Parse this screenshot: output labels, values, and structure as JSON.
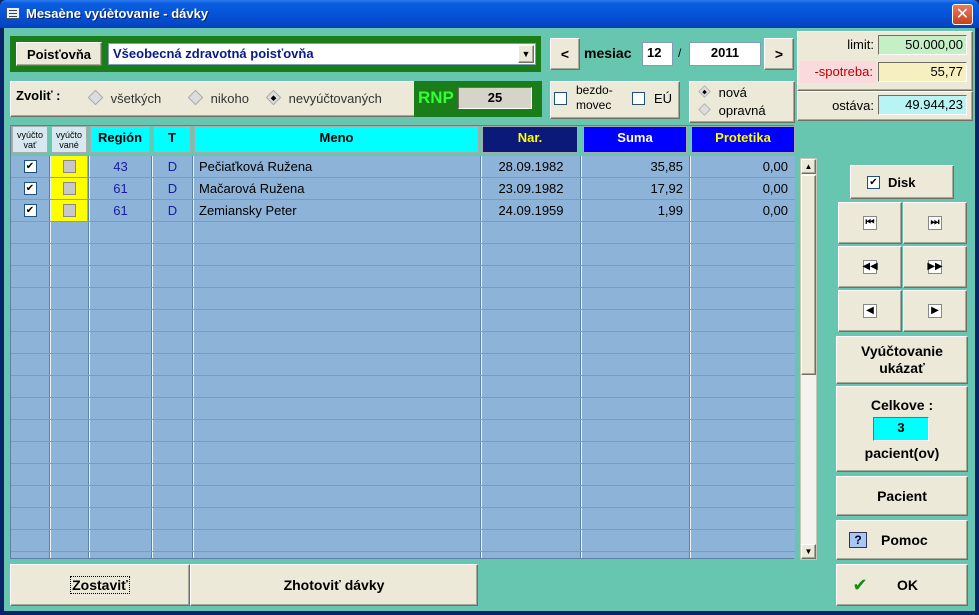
{
  "window": {
    "title": "Mesaène vyúètovanie - dávky"
  },
  "header": {
    "poistovna_label": "Poisťovňa",
    "poistovna_value": "Všeobecná zdravotná poisťovňa",
    "mesiac_label": "mesiac",
    "month": "12",
    "year": "2011",
    "separator": "/",
    "prev": "<",
    "next": ">"
  },
  "summary": {
    "limit_label": "limit:",
    "limit_value": "50.000,00",
    "spotreba_label": "-spotreba:",
    "spotreba_value": "55,77",
    "ostava_label": "ostáva:",
    "ostava_value": "49.944,23"
  },
  "filter": {
    "label": "Zvoliť :",
    "options": [
      "všetkých",
      "nikoho",
      "nevyúčtovaných"
    ],
    "selected": 2,
    "rnp_label": "RNP",
    "rnp_value": "25"
  },
  "flags": {
    "bezdomovec": "bezdo- movec",
    "bezdomovec_line1": "bezdo-",
    "bezdomovec_line2": "movec",
    "eu": "EÚ",
    "nova": "nová",
    "opravna": "opravná"
  },
  "table": {
    "headers": [
      "vyúčto vať",
      "vyúčto vané",
      "Región",
      "T",
      "Meno",
      "Nar.",
      "Suma",
      "Protetika"
    ],
    "rows": [
      {
        "vyuctovat": true,
        "vyuctovane": false,
        "region": "43",
        "t": "D",
        "meno": "Pečiaťková Ružena",
        "nar": "28.09.1982",
        "suma": "35,85",
        "protetika": "0,00"
      },
      {
        "vyuctovat": true,
        "vyuctovane": false,
        "region": "61",
        "t": "D",
        "meno": "Mačarová Ružena",
        "nar": "23.09.1982",
        "suma": "17,92",
        "protetika": "0,00"
      },
      {
        "vyuctovat": true,
        "vyuctovane": false,
        "region": "61",
        "t": "D",
        "meno": "Zemiansky Peter",
        "nar": "24.09.1959",
        "suma": "1,99",
        "protetika": "0,00"
      }
    ]
  },
  "side": {
    "disk_label": "Disk",
    "vyuctovanie_line1": "Vyúčtovanie",
    "vyuctovanie_line2": "ukázať",
    "celkove_label": "Celkove :",
    "celkove_value": "3",
    "pacient_ov": "pacient(ov)",
    "pacient": "Pacient",
    "pomoc": "Pomoc",
    "ok": "OK"
  },
  "footer": {
    "zostavit": "Zostaviť",
    "zhotovit": "Zhotoviť dávky"
  },
  "colors": {
    "client_bg": "#67c6b0",
    "grid_bg": "#8eb3d9",
    "cyan_header": "#00ffff",
    "navy_header": "#0b1a78",
    "blue_header": "#0000ff",
    "yellow_text": "#ffff00",
    "green_frame": "#1a7d1a"
  }
}
